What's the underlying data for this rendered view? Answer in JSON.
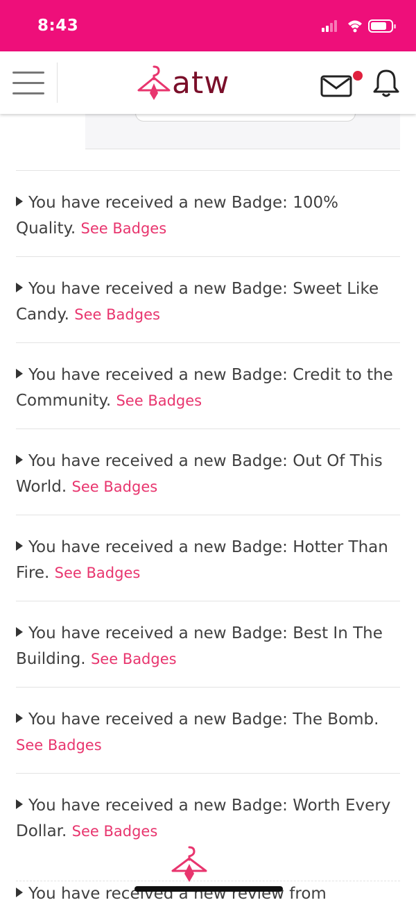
{
  "status_bar": {
    "time": "8:43",
    "icons": [
      "signal-icon",
      "wifi-icon",
      "battery-icon"
    ],
    "background": "#ee0f7a"
  },
  "header": {
    "logo_text": "atw",
    "logo_color": "#7a0f2a",
    "accent": "#e8356e",
    "mail_unread": true
  },
  "notifications": [
    {
      "text": "You have received a new Badge: 100% Quality.",
      "link": "See Badges"
    },
    {
      "text": "You have received a new Badge: Sweet Like Candy.",
      "link": "See Badges"
    },
    {
      "text": "You have received a new Badge: Credit to the Community.",
      "link": "See Badges"
    },
    {
      "text": "You have received a new Badge: Out Of This World.",
      "link": "See Badges"
    },
    {
      "text": "You have received a new Badge: Hotter Than Fire.",
      "link": "See Badges"
    },
    {
      "text": "You have received a new Badge: Best In The Building.",
      "link": "See Badges"
    },
    {
      "text": "You have received a new Badge: The Bomb.",
      "link": "See Badges"
    },
    {
      "text": "You have received a new Badge: Worth Every Dollar.",
      "link": "See Badges"
    }
  ],
  "partial_item": {
    "text": "You have received a new review from"
  }
}
